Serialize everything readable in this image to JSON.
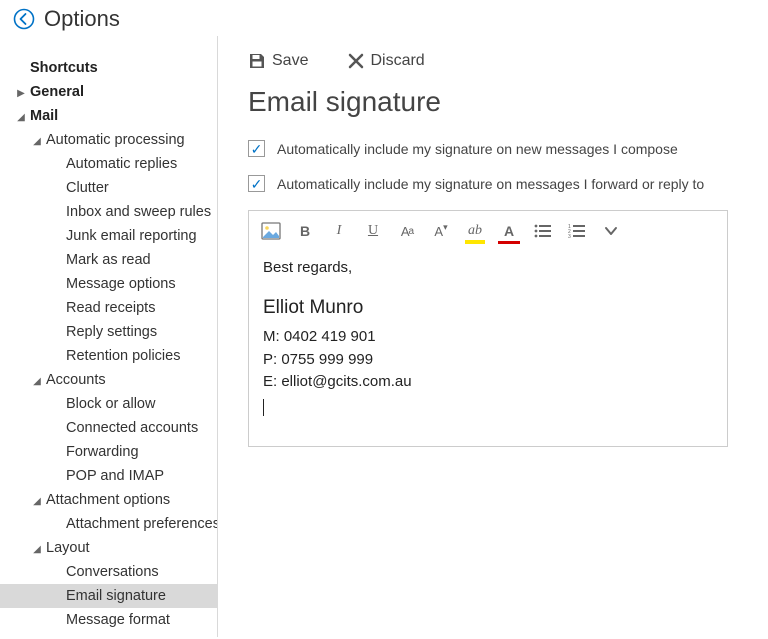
{
  "header": {
    "title": "Options"
  },
  "sidebar": {
    "shortcuts": "Shortcuts",
    "general": "General",
    "mail": "Mail",
    "autoproc": {
      "label": "Automatic processing",
      "autoreplies": "Automatic replies",
      "clutter": "Clutter",
      "sweep": "Inbox and sweep rules",
      "junk": "Junk email reporting",
      "markread": "Mark as read",
      "msgopts": "Message options",
      "readreceipts": "Read receipts",
      "replysettings": "Reply settings",
      "retention": "Retention policies"
    },
    "accounts": {
      "label": "Accounts",
      "block": "Block or allow",
      "connected": "Connected accounts",
      "forwarding": "Forwarding",
      "pop": "POP and IMAP"
    },
    "attachment": {
      "label": "Attachment options",
      "prefs": "Attachment preferences"
    },
    "layout": {
      "label": "Layout",
      "conversations": "Conversations",
      "signature": "Email signature",
      "msgformat": "Message format"
    }
  },
  "actions": {
    "save": "Save",
    "discard": "Discard"
  },
  "page": {
    "title": "Email signature",
    "chk_new": "Automatically include my signature on new messages I compose",
    "chk_fwdreply": "Automatically include my signature on messages I forward or reply to"
  },
  "signature": {
    "greeting": "Best regards,",
    "name": "Elliot Munro",
    "mobile": "M: 0402 419 901",
    "phone": "P: 0755 999 999",
    "email": "E: elliot@gcits.com.au"
  }
}
